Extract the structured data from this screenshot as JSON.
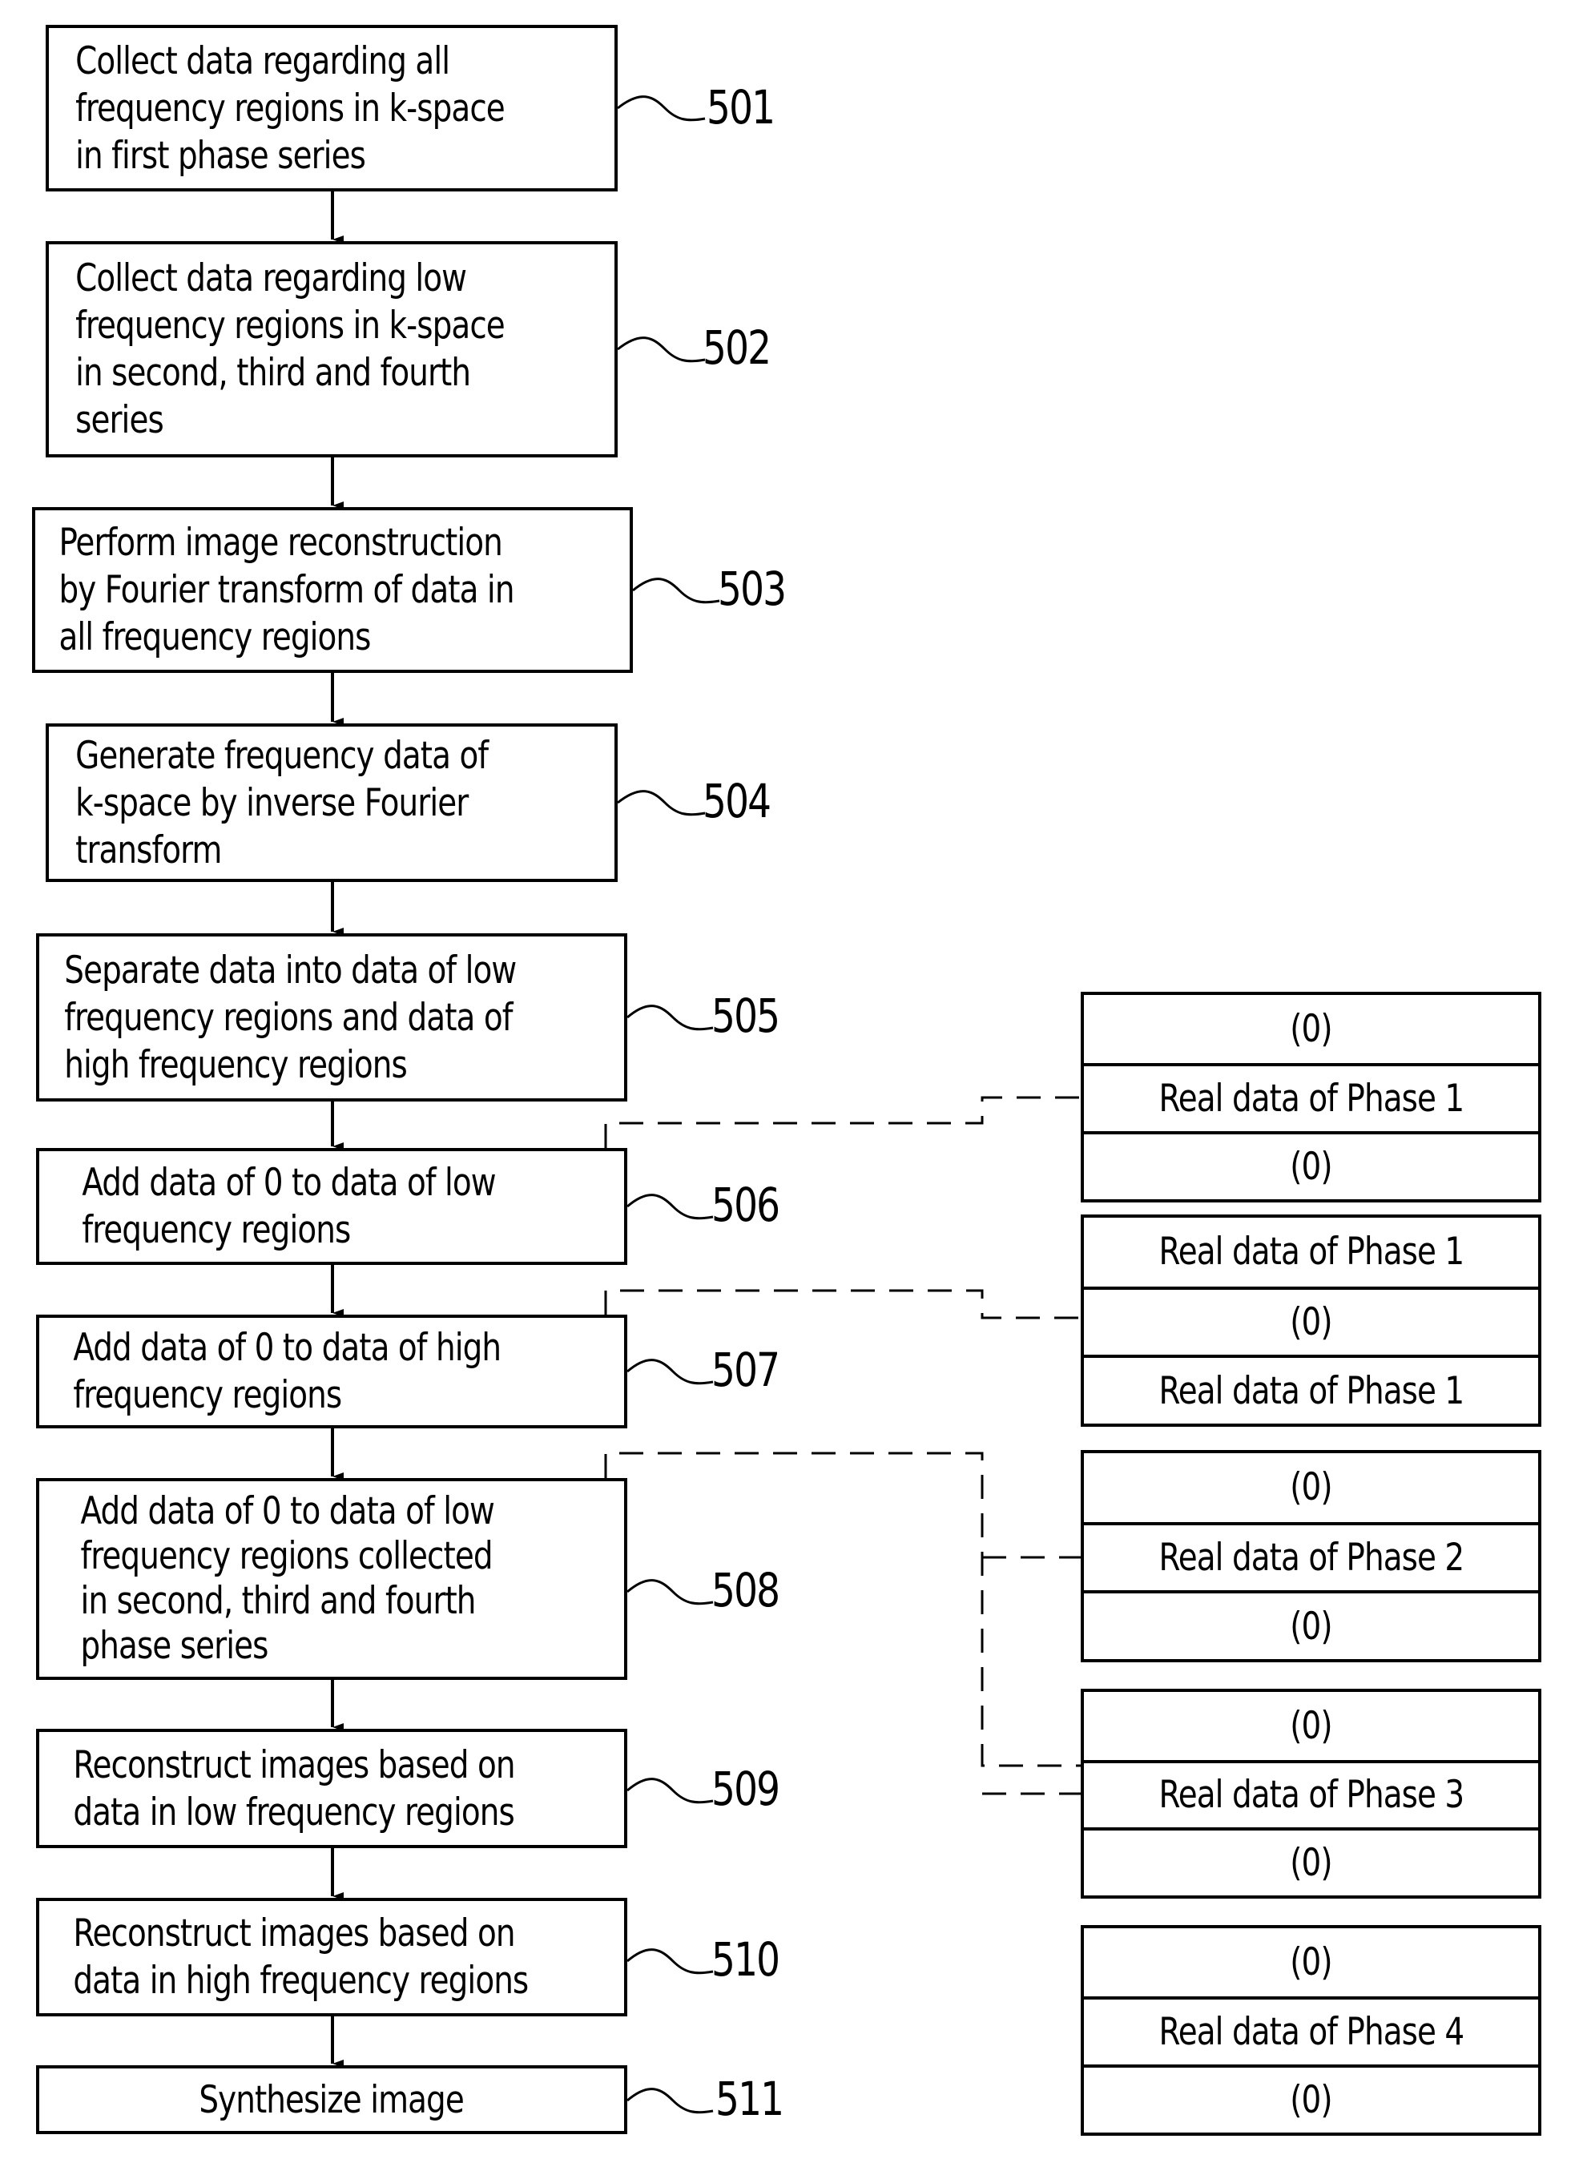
{
  "steps": [
    {
      "ref": "501",
      "text": "Collect data regarding all\nfrequency regions in k-space\nin first phase series"
    },
    {
      "ref": "502",
      "text": "Collect data regarding low\nfrequency regions in k-space\nin second, third and fourth\nseries"
    },
    {
      "ref": "503",
      "text": "Perform image reconstruction\nby Fourier transform of data in\nall frequency regions"
    },
    {
      "ref": "504",
      "text": "Generate frequency data of\nk-space by inverse Fourier\ntransform"
    },
    {
      "ref": "505",
      "text": "Separate data into data of low\nfrequency regions and data of\nhigh frequency regions"
    },
    {
      "ref": "506",
      "text": "Add data of 0 to data of low\nfrequency regions"
    },
    {
      "ref": "507",
      "text": "Add data of 0 to data of high\nfrequency regions"
    },
    {
      "ref": "508",
      "text": "Add data of 0 to data of low\nfrequency regions collected\nin second, third and fourth\nphase series"
    },
    {
      "ref": "509",
      "text": "Reconstruct images based on\ndata in low frequency regions"
    },
    {
      "ref": "510",
      "text": "Reconstruct images based on\ndata in high frequency regions"
    },
    {
      "ref": "511",
      "text": "Synthesize image"
    }
  ],
  "data_stacks": [
    {
      "cells": [
        "(0)",
        "Real data of Phase 1",
        "(0)"
      ]
    },
    {
      "cells": [
        "Real data of Phase 1",
        "(0)",
        "Real data of Phase 1"
      ]
    },
    {
      "cells": [
        "(0)",
        "Real data of Phase 2",
        "(0)"
      ]
    },
    {
      "cells": [
        "(0)",
        "Real data of Phase 3",
        "(0)"
      ]
    },
    {
      "cells": [
        "(0)",
        "Real data of Phase 4",
        "(0)"
      ]
    }
  ]
}
